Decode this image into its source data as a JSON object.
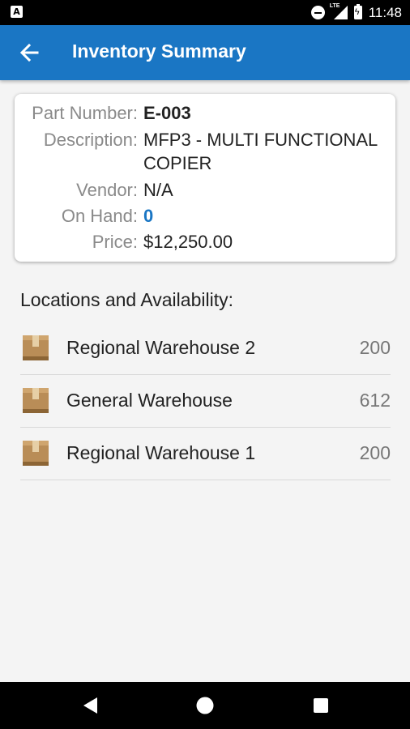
{
  "status_bar": {
    "notification_icon": "A",
    "network": "LTE",
    "time": "11:48"
  },
  "app_bar": {
    "back_icon": "arrow-left-icon",
    "title": "Inventory Summary",
    "color": "#1a76c4"
  },
  "details": {
    "part_number": {
      "label": "Part Number:",
      "value": "E-003"
    },
    "description": {
      "label": "Description:",
      "value_line1": "MFP3 - MULTI FUNCTIONAL",
      "value_line2": "COPIER"
    },
    "vendor": {
      "label": "Vendor:",
      "value": "N/A"
    },
    "on_hand": {
      "label": "On Hand:",
      "value": "0"
    },
    "price": {
      "label": "Price:",
      "value": "$12,250.00"
    }
  },
  "locations": {
    "title": "Locations and Availability:",
    "items": [
      {
        "name": "Regional Warehouse 2",
        "qty": "200",
        "icon": "box-icon"
      },
      {
        "name": "General Warehouse",
        "qty": "612",
        "icon": "box-icon"
      },
      {
        "name": "Regional Warehouse 1",
        "qty": "200",
        "icon": "box-icon"
      }
    ]
  },
  "nav_bar": {
    "back": "nav-back-icon",
    "home": "nav-home-icon",
    "recents": "nav-recents-icon"
  }
}
